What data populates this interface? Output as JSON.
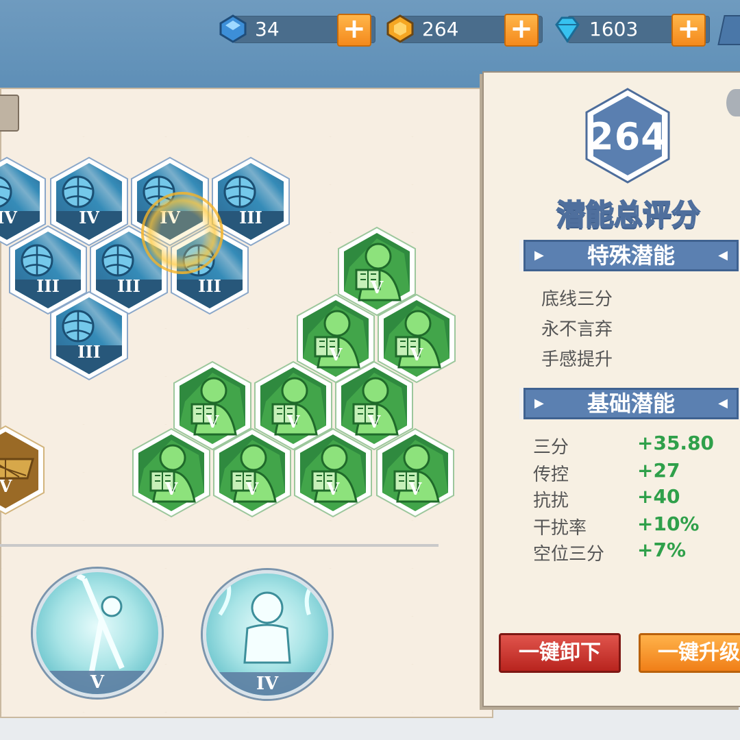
{
  "currencies": [
    {
      "name": "blue-gem",
      "value": "34",
      "color": "#3fa2e6"
    },
    {
      "name": "gold-coin",
      "value": "264",
      "color": "#f5a623"
    },
    {
      "name": "diamond",
      "value": "1603",
      "color": "#37c2f0"
    }
  ],
  "plus_label": "+",
  "hex_grid": {
    "blue_levels": [
      "IV",
      "IV",
      "IV",
      "III",
      "III",
      "III",
      "III",
      "III"
    ],
    "green_levels": [
      "V",
      "V",
      "V",
      "V",
      "V",
      "V",
      "V",
      "V",
      "V",
      "V"
    ],
    "gold_levels": [
      "V"
    ]
  },
  "skills": [
    {
      "name": "shooting-skill",
      "level": "V"
    },
    {
      "name": "power-skill",
      "level": "IV"
    }
  ],
  "side_panel": {
    "score": "264",
    "score_title": "潜能总评分",
    "special_title": "特殊潜能",
    "special_items": [
      "底线三分",
      "永不言弃",
      "手感提升"
    ],
    "basic_title": "基础潜能",
    "stats": [
      {
        "label": "三分",
        "value": "+35.80"
      },
      {
        "label": "传控",
        "value": "+27"
      },
      {
        "label": "抗扰",
        "value": "+40"
      },
      {
        "label": "干扰率",
        "value": "+10%"
      },
      {
        "label": "空位三分",
        "value": "+7%"
      }
    ],
    "unload_label": "一键卸下",
    "upgrade_label": "一键升级"
  },
  "arrow_left": "▶",
  "arrow_right": "◀"
}
